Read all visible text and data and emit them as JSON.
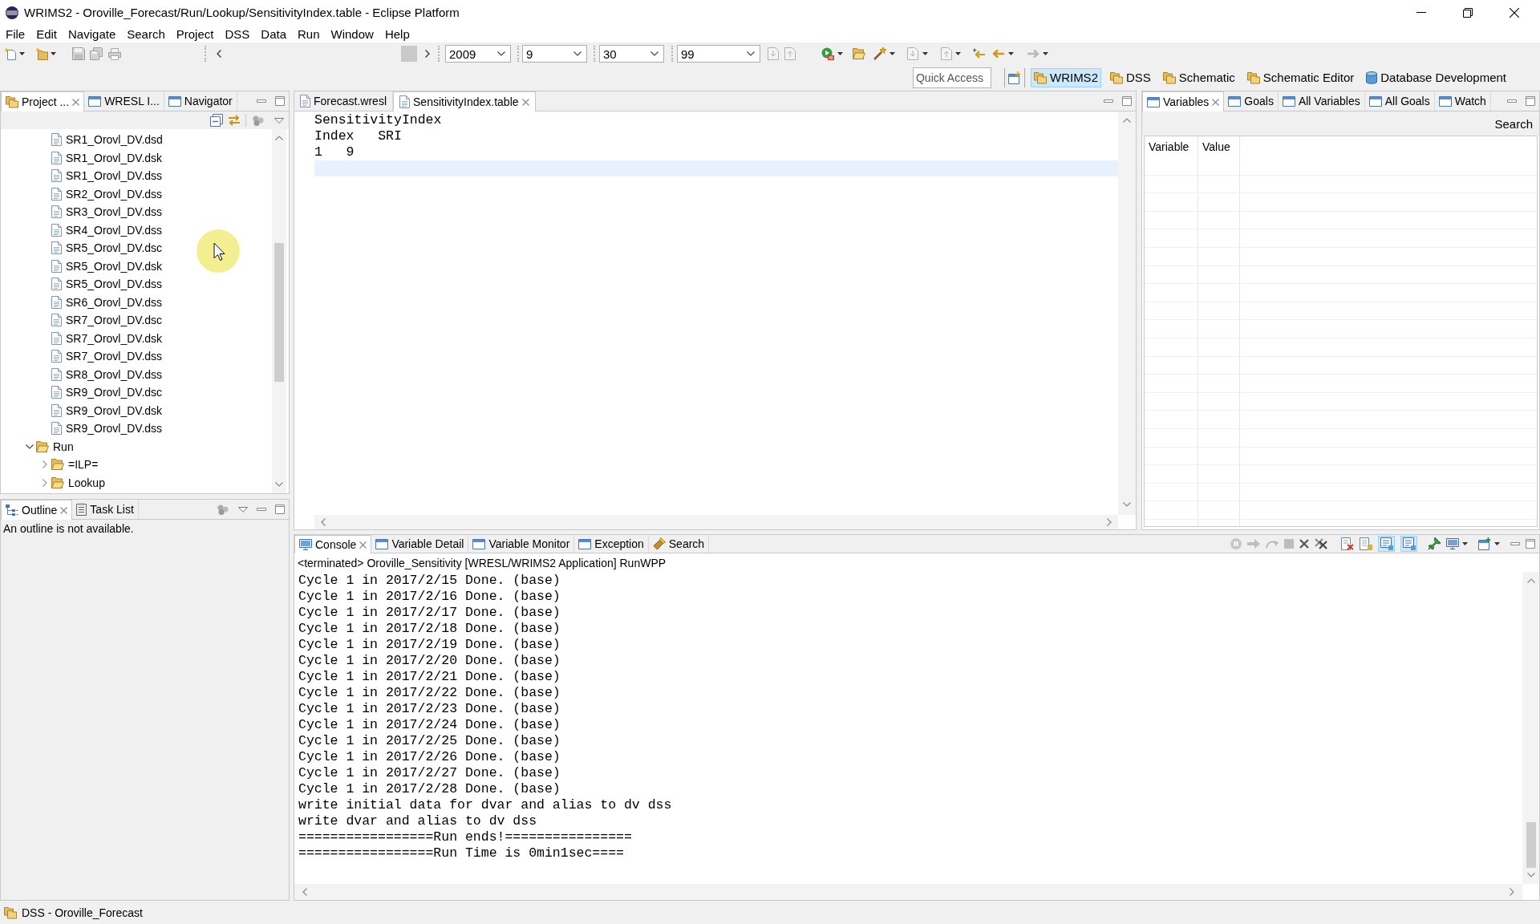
{
  "window": {
    "title": "WRIMS2 - Oroville_Forecast/Run/Lookup/SensitivityIndex.table - Eclipse Platform"
  },
  "menu": [
    "File",
    "Edit",
    "Navigate",
    "Search",
    "Project",
    "DSS",
    "Data",
    "Run",
    "Window",
    "Help"
  ],
  "toolbar": {
    "combos": [
      {
        "value": "2009"
      },
      {
        "value": "9"
      },
      {
        "value": "30"
      },
      {
        "value": "99"
      }
    ],
    "quick_access": {
      "placeholder": "Quick Access"
    },
    "perspectives": [
      {
        "label": "WRIMS2",
        "kind": "folder",
        "selected": true
      },
      {
        "label": "DSS",
        "kind": "folder",
        "selected": false
      },
      {
        "label": "Schematic",
        "kind": "folder",
        "selected": false
      },
      {
        "label": "Schematic Editor",
        "kind": "folder",
        "selected": false
      },
      {
        "label": "Database Development",
        "kind": "database",
        "selected": false
      }
    ]
  },
  "explorer": {
    "tabs": [
      {
        "label": "Project ...",
        "kind": "project",
        "selected": true
      },
      {
        "label": "WRESL I...",
        "kind": "view",
        "selected": false
      },
      {
        "label": "Navigator",
        "kind": "view",
        "selected": false
      }
    ],
    "tree": [
      {
        "children": [
          {
            "kind": "file",
            "label": "SR1_Orovl_DV.dsd"
          },
          {
            "kind": "file",
            "label": "SR1_Orovl_DV.dsk"
          },
          {
            "kind": "file",
            "label": "SR1_Orovl_DV.dss"
          },
          {
            "kind": "file",
            "label": "SR2_Orovl_DV.dss"
          },
          {
            "kind": "file",
            "label": "SR3_Orovl_DV.dss"
          },
          {
            "kind": "file",
            "label": "SR4_Orovl_DV.dss"
          },
          {
            "kind": "file",
            "label": "SR5_Orovl_DV.dsc"
          },
          {
            "kind": "file",
            "label": "SR5_Orovl_DV.dsk"
          },
          {
            "kind": "file",
            "label": "SR5_Orovl_DV.dss"
          },
          {
            "kind": "file",
            "label": "SR6_Orovl_DV.dss"
          },
          {
            "kind": "file",
            "label": "SR7_Orovl_DV.dsc"
          },
          {
            "kind": "file",
            "label": "SR7_Orovl_DV.dsk"
          },
          {
            "kind": "file",
            "label": "SR7_Orovl_DV.dss"
          },
          {
            "kind": "file",
            "label": "SR8_Orovl_DV.dss"
          },
          {
            "kind": "file",
            "label": "SR9_Orovl_DV.dsc"
          },
          {
            "kind": "file",
            "label": "SR9_Orovl_DV.dsk"
          },
          {
            "kind": "file",
            "label": "SR9_Orovl_DV.dss"
          }
        ]
      },
      {
        "kind": "folder",
        "label": "Run",
        "expanded": true,
        "children": [
          {
            "kind": "folder",
            "label": "=ILP=",
            "expanded": false
          },
          {
            "kind": "folder",
            "label": "Lookup",
            "expanded": false
          }
        ]
      }
    ]
  },
  "editor": {
    "tabs": [
      {
        "label": "Forecast.wresl",
        "selected": false
      },
      {
        "label": "SensitivityIndex.table",
        "selected": true
      }
    ],
    "lines": [
      "SensitivityIndex",
      "Index   SRI",
      "1   9"
    ],
    "cursor_on_blank_line": true
  },
  "variables": {
    "tabs": [
      {
        "label": "Variables",
        "selected": true
      },
      {
        "label": "Goals",
        "selected": false
      },
      {
        "label": "All Variables",
        "selected": false
      },
      {
        "label": "All Goals",
        "selected": false
      },
      {
        "label": "Watch",
        "selected": false
      }
    ],
    "search": "Search",
    "columns": [
      "Variable",
      "Value"
    ]
  },
  "outline": {
    "tabs": [
      {
        "label": "Outline",
        "kind": "outline",
        "selected": true
      },
      {
        "label": "Task List",
        "kind": "tasks",
        "selected": false
      }
    ],
    "message": "An outline is not available."
  },
  "console": {
    "tabs": [
      {
        "label": "Console",
        "kind": "console",
        "selected": true
      },
      {
        "label": "Variable Detail",
        "kind": "view",
        "selected": false
      },
      {
        "label": "Variable Monitor",
        "kind": "view",
        "selected": false
      },
      {
        "label": "Exception",
        "kind": "view",
        "selected": false
      },
      {
        "label": "Search",
        "kind": "search",
        "selected": false
      }
    ],
    "header": "<terminated> Oroville_Sensitivity [WRESL/WRIMS2 Application] RunWPP",
    "toggles": [
      {
        "on": true
      },
      {
        "on": true
      }
    ],
    "lines": [
      "Cycle 1 in 2017/2/15 Done. (base)",
      "Cycle 1 in 2017/2/16 Done. (base)",
      "Cycle 1 in 2017/2/17 Done. (base)",
      "Cycle 1 in 2017/2/18 Done. (base)",
      "Cycle 1 in 2017/2/19 Done. (base)",
      "Cycle 1 in 2017/2/20 Done. (base)",
      "Cycle 1 in 2017/2/21 Done. (base)",
      "Cycle 1 in 2017/2/22 Done. (base)",
      "Cycle 1 in 2017/2/23 Done. (base)",
      "Cycle 1 in 2017/2/24 Done. (base)",
      "Cycle 1 in 2017/2/25 Done. (base)",
      "Cycle 1 in 2017/2/26 Done. (base)",
      "Cycle 1 in 2017/2/27 Done. (base)",
      "Cycle 1 in 2017/2/28 Done. (base)",
      "write initial data for dvar and alias to dv dss",
      "write dvar and alias to dv dss",
      "=================Run ends!================",
      "=================Run Time is 0min1sec===="
    ]
  },
  "status_bar": {
    "text": "DSS - Oroville_Forecast"
  }
}
